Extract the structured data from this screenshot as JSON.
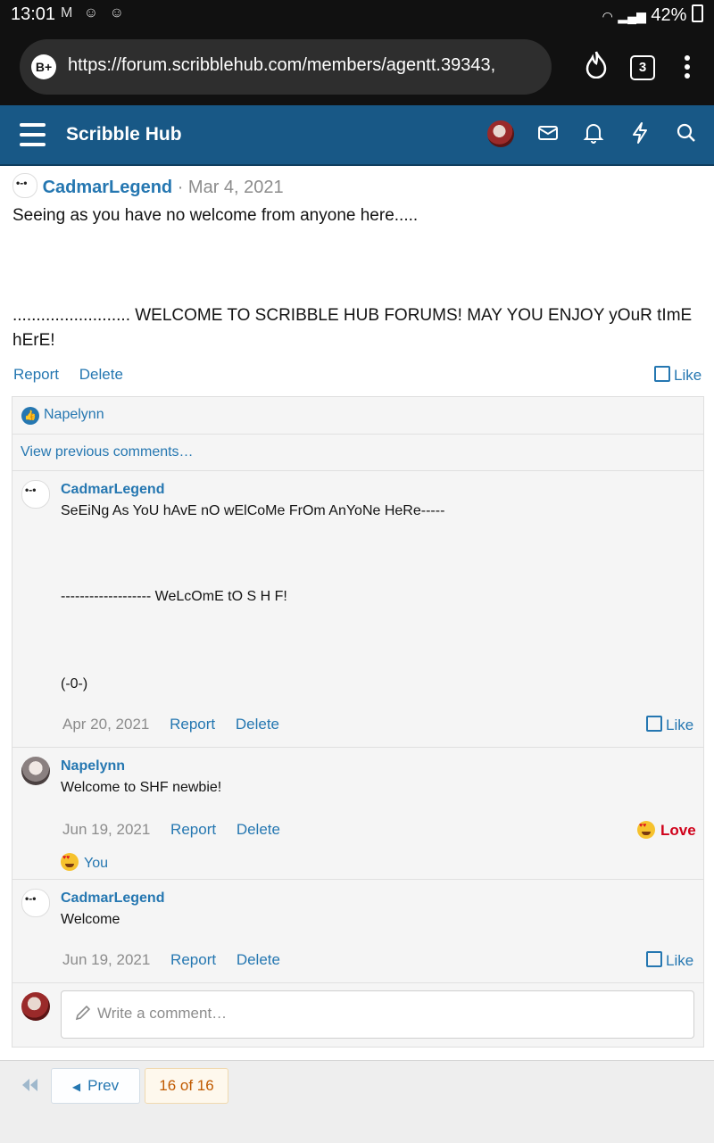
{
  "status_bar": {
    "time": "13:01",
    "notification_icons": [
      "gmail-icon",
      "discord-icon",
      "discord-icon"
    ],
    "battery": "42%"
  },
  "browser": {
    "badge": "B+",
    "url": "https://forum.scribblehub.com/members/agentt.39343,",
    "tab_count": "3"
  },
  "site": {
    "title": "Scribble Hub"
  },
  "post": {
    "author": "CadmarLegend",
    "date": "· Mar 4, 2021",
    "body_line1": "Seeing as you have no welcome from anyone here.....",
    "body_line2": "......................... WELCOME TO SCRIBBLE HUB FORUMS! MAY YOU ENJOY yOuR tImE hErE!",
    "report": "Report",
    "delete": "Delete",
    "like": "Like"
  },
  "reactions": {
    "user": "Napelynn"
  },
  "view_previous": "View previous comments…",
  "comments": [
    {
      "author": "CadmarLegend",
      "line1": "SeEiNg As YoU hAvE nO wElCoMe FrOm AnYoNe HeRe-----",
      "line2": "------------------- WeLcOmE tO S H F!",
      "line3": "(-0-)",
      "date": "Apr 20, 2021",
      "report": "Report",
      "delete": "Delete",
      "reaction": "Like"
    },
    {
      "author": "Napelynn",
      "line1": "Welcome to SHF newbie!",
      "date": "Jun 19, 2021",
      "report": "Report",
      "delete": "Delete",
      "reaction": "Love",
      "reacted_by": "You"
    },
    {
      "author": "CadmarLegend",
      "line1": "Welcome",
      "date": "Jun 19, 2021",
      "report": "Report",
      "delete": "Delete",
      "reaction": "Like"
    }
  ],
  "comment_box": {
    "placeholder": "Write a comment…"
  },
  "pagination": {
    "prev": "Prev",
    "page": "16 of 16"
  },
  "colors": {
    "brand": "#185886",
    "link": "#2577b1",
    "love": "#d0021b",
    "page_badge_bg": "#fef8ed"
  }
}
